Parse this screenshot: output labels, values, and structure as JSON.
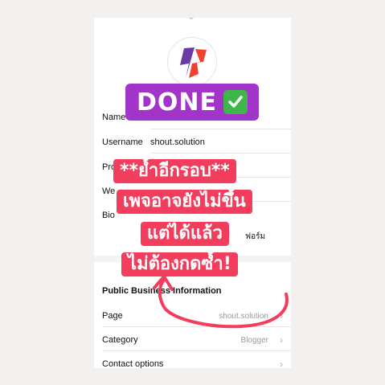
{
  "profile": {
    "fields": [
      {
        "label": "Name",
        "value": ""
      },
      {
        "label": "Username",
        "value": "shout.solution"
      },
      {
        "label": "Pro",
        "value": ""
      },
      {
        "label": "We",
        "value": ""
      },
      {
        "label": "Bio",
        "value": "ฟอร์ม"
      }
    ]
  },
  "business": {
    "section_title": "Public Business Information",
    "rows": [
      {
        "label": "Page",
        "value": "shout.solution"
      },
      {
        "label": "Category",
        "value": "Blogger"
      },
      {
        "label": "Contact options",
        "value": ""
      }
    ]
  },
  "badge": {
    "text": "DONE"
  },
  "overlay": {
    "lines": [
      "**ย้ำอีกรอบ**",
      "เพจอาจยังไม่ขึ้น",
      "แต่ได้แล้ว",
      "ไม่ต้องกดซ้ำ!"
    ]
  },
  "colors": {
    "badge_bg": "#a334c9",
    "overlay_bg": "#f23d5c",
    "arrow": "#f23d5c",
    "check_bg": "#3fb54a"
  },
  "icons": {
    "logo": "shout-logo-icon",
    "check": "check-mark-icon",
    "chevron": "chevron-right-icon"
  }
}
